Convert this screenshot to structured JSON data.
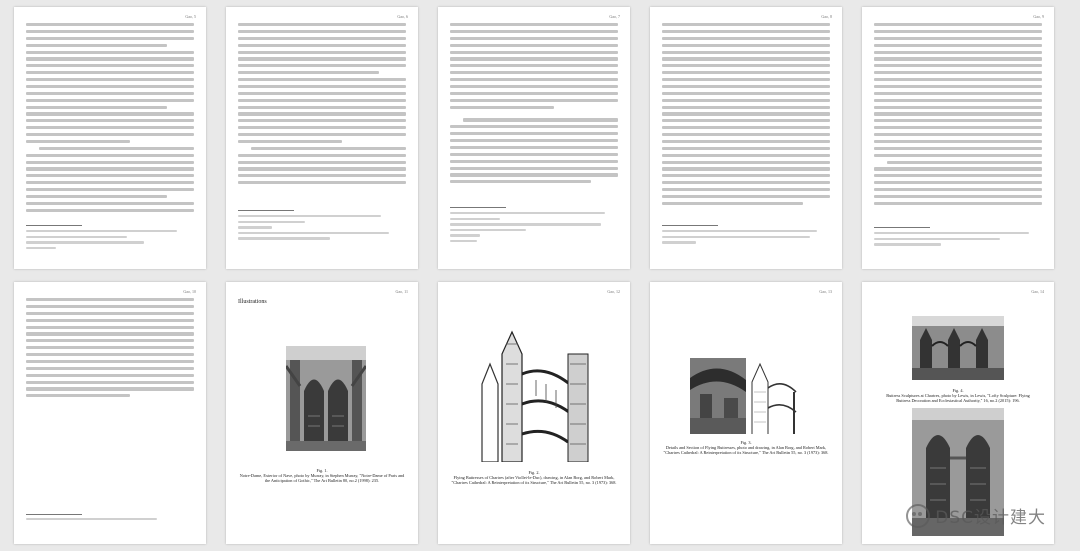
{
  "pages": [
    {
      "header": "Gao, 5",
      "footnotes": [
        "9   Chester, Reid, High Gothic in France, 7 (Gothic Cathedrals)",
        "10   Ibid., 24.",
        "11   Ibid., 45."
      ]
    },
    {
      "header": "Gao, 6",
      "footnotes": [
        "12   Dan Anstey, High Gothic: The Classic Cathedrals of Chartres, Reims, Amiens",
        "13   Ibid., 86.",
        "14   Ibid."
      ]
    },
    {
      "header": "Gao, 7",
      "footnotes": [
        "15   Antonio Rizzi, Construction History",
        "16   Mark, Robert and Hutchinson",
        "17   Ibid., 602."
      ]
    },
    {
      "header": "Gao, 8",
      "footnotes": [
        "18   Vincent Flying Buttresses",
        "19   Ibid."
      ]
    },
    {
      "header": "Gao, 9",
      "footnotes": [
        "20   Early Gothic Sculpture",
        "21   Ibid., 47."
      ]
    },
    {
      "header": "Gao, 10",
      "footnotes": [
        "22   Murray, \"Notre-Dame of Paris and the Anticipation of Gothic,\" 230."
      ]
    },
    {
      "header": "Gao, 11",
      "title": "Illustrations",
      "caption": [
        "Fig. 1.",
        "Notre-Dame, Exterior of Nave, photo by Murray, in Stephen Murray, \"Notre-Dame of Paris and",
        "the Anticipation of Gothic,\" The Art Bulletin 80, no.2 (1998): 235."
      ]
    },
    {
      "header": "Gao, 12",
      "caption": [
        "Fig. 2.",
        "Flying Buttresses of Chartres (after Viollet-le-Duc), drawing, in Alan Borg, and Robert Mark,",
        "\"Chartres Cathedral: A Reinterpretation of its Structure,\" The Art Bulletin 55, no. 3 (1973): 368."
      ]
    },
    {
      "header": "Gao, 13",
      "caption": [
        "Fig. 3.",
        "Details and Section of Flying Buttresses, photo and drawing, in Alan Borg, and Robert Mark,",
        "\"Chartres Cathedral: A Reinterpretation of its Structure,\" The Art Bulletin 55, no. 3 (1973): 368."
      ]
    },
    {
      "header": "Gao, 14",
      "caption": [
        "Fig. 4.",
        "Buttress Sculptures at Chartres, photo by Lewis, in Lewis, \"Lofty Sculpture: Flying",
        "Buttress Decoration and Ecclesiastical Authority,\" 16, no.2 (2015): 196."
      ]
    }
  ],
  "watermark": "DSC设计建大"
}
